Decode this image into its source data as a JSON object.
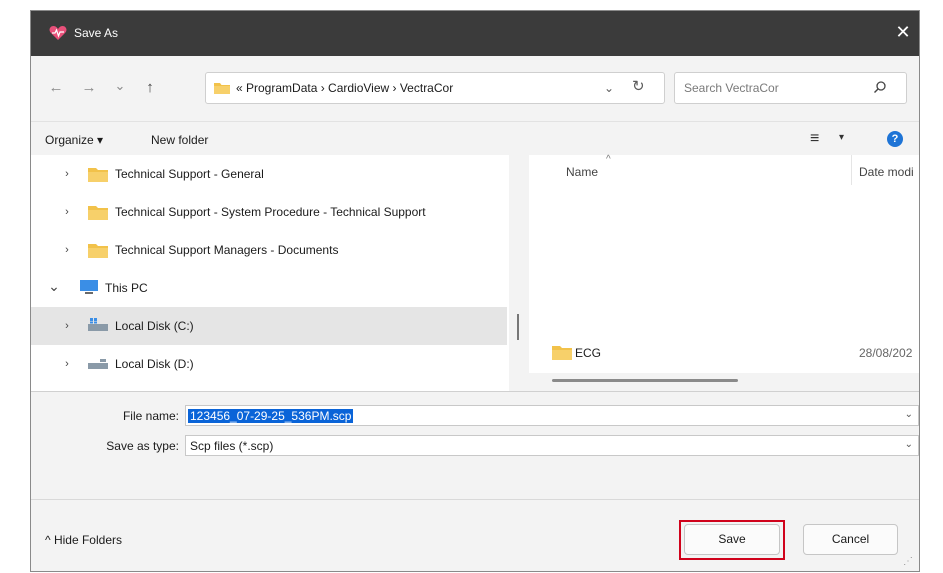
{
  "window": {
    "title": "Save As",
    "close_glyph": "✕"
  },
  "nav": {
    "back_glyph": "←",
    "forward_glyph": "→",
    "recent_glyph": "⌄",
    "up_glyph": "↑",
    "address_text": "« ProgramData  ›  CardioView  ›  VectraCor",
    "address_drop_glyph": "⌄",
    "refresh_glyph": "↻",
    "search_placeholder": "Search VectraCor"
  },
  "toolbar": {
    "organize_label": "Organize ▾",
    "new_folder_label": "New folder",
    "view_glyph": "≡",
    "view_drop_glyph": "▾",
    "help_glyph": "?"
  },
  "tree": [
    {
      "label": "Technical Support - General",
      "chevron": "›",
      "icon": "folder-icon"
    },
    {
      "label": "Technical Support - System Procedure - Technical Support",
      "chevron": "›",
      "icon": "folder-icon"
    },
    {
      "label": "Technical Support Managers - Documents",
      "chevron": "›",
      "icon": "folder-icon"
    },
    {
      "label": "This PC",
      "chevron": "⌄",
      "icon": "pc-icon"
    },
    {
      "label": "Local Disk (C:)",
      "chevron": "›",
      "icon": "disk-icon",
      "selected": true
    },
    {
      "label": "Local Disk (D:)",
      "chevron": "›",
      "icon": "disk-icon"
    }
  ],
  "file_list": {
    "col_name": "Name",
    "col_date": "Date modi",
    "sort_glyph": "^",
    "items": [
      {
        "name": "ECG",
        "date": "28/08/202"
      }
    ]
  },
  "fields": {
    "filename_label": "File name:",
    "filename_value": "123456_07-29-25_536PM.scp",
    "type_label": "Save as type:",
    "type_value": "Scp files (*.scp)",
    "drop_glyph": "⌄"
  },
  "footer": {
    "hide_folders_label": "^  Hide Folders",
    "save_label": "Save",
    "cancel_label": "Cancel",
    "grip_glyph": "⋰"
  },
  "colors": {
    "titlebar": "#3b3b3b",
    "folder": "#f2c24a",
    "accent": "#0a64d8",
    "highlight_outline": "#d0021b"
  }
}
